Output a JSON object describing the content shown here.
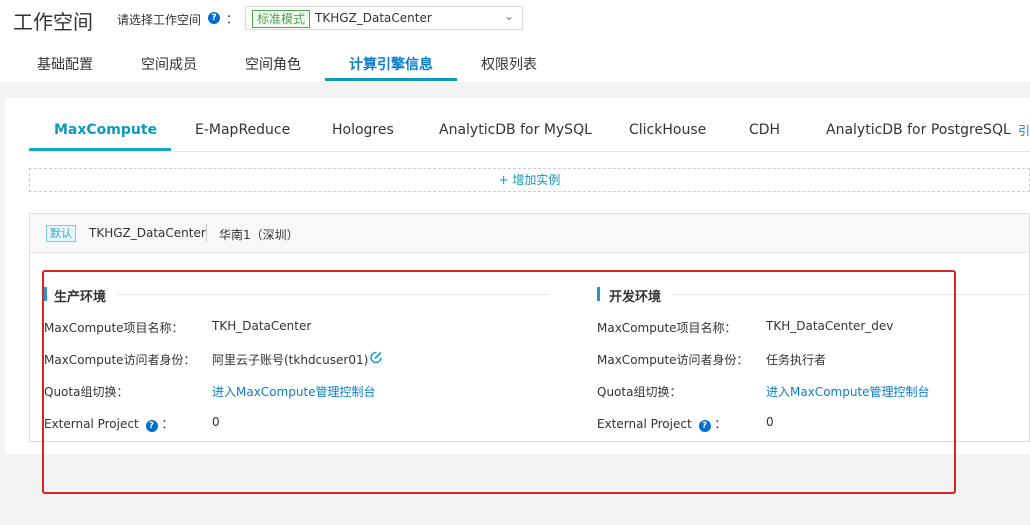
{
  "header": {
    "title": "工作空间",
    "select_label": "请选择工作空间",
    "colon": "：",
    "mode_badge": "标准模式",
    "workspace_name": "TKHGZ_DataCenter"
  },
  "top_tabs": [
    {
      "label": "基础配置"
    },
    {
      "label": "空间成员"
    },
    {
      "label": "空间角色"
    },
    {
      "label": "计算引擎信息",
      "active": true
    },
    {
      "label": "权限列表"
    }
  ],
  "engine_tabs": [
    {
      "label": "MaxCompute",
      "active": true
    },
    {
      "label": "E-MapReduce"
    },
    {
      "label": "Hologres"
    },
    {
      "label": "AnalyticDB for MySQL"
    },
    {
      "label": "ClickHouse"
    },
    {
      "label": "CDH"
    },
    {
      "label": "AnalyticDB for PostgreSQL"
    }
  ],
  "engine_tabs_more": "引",
  "add_instance": "+ 增加实例",
  "card": {
    "default_badge": "默认",
    "workspace": "TKHGZ_DataCenter",
    "region": "华南1（深圳）"
  },
  "prod": {
    "title": "生产环境",
    "rows": [
      {
        "label": "MaxCompute项目名称：",
        "value": "TKH_DataCenter"
      },
      {
        "label": "MaxCompute访问者身份：",
        "value": "阿里云子账号(tkhdcuser01)"
      },
      {
        "label": "Quota组切换：",
        "value": "进入MaxCompute管理控制台"
      },
      {
        "label": "External Project",
        "value": "0"
      }
    ]
  },
  "dev": {
    "title": "开发环境",
    "rows": [
      {
        "label": "MaxCompute项目名称：",
        "value": "TKH_DataCenter_dev"
      },
      {
        "label": "MaxCompute访问者身份：",
        "value": "任务执行者"
      },
      {
        "label": "Quota组切换：",
        "value": "进入MaxCompute管理控制台"
      },
      {
        "label": "External Project",
        "value": "0"
      }
    ]
  },
  "colors": {
    "accent": "#0a99c2",
    "link": "#0a7fcd",
    "highlight_box": "#e02020"
  }
}
